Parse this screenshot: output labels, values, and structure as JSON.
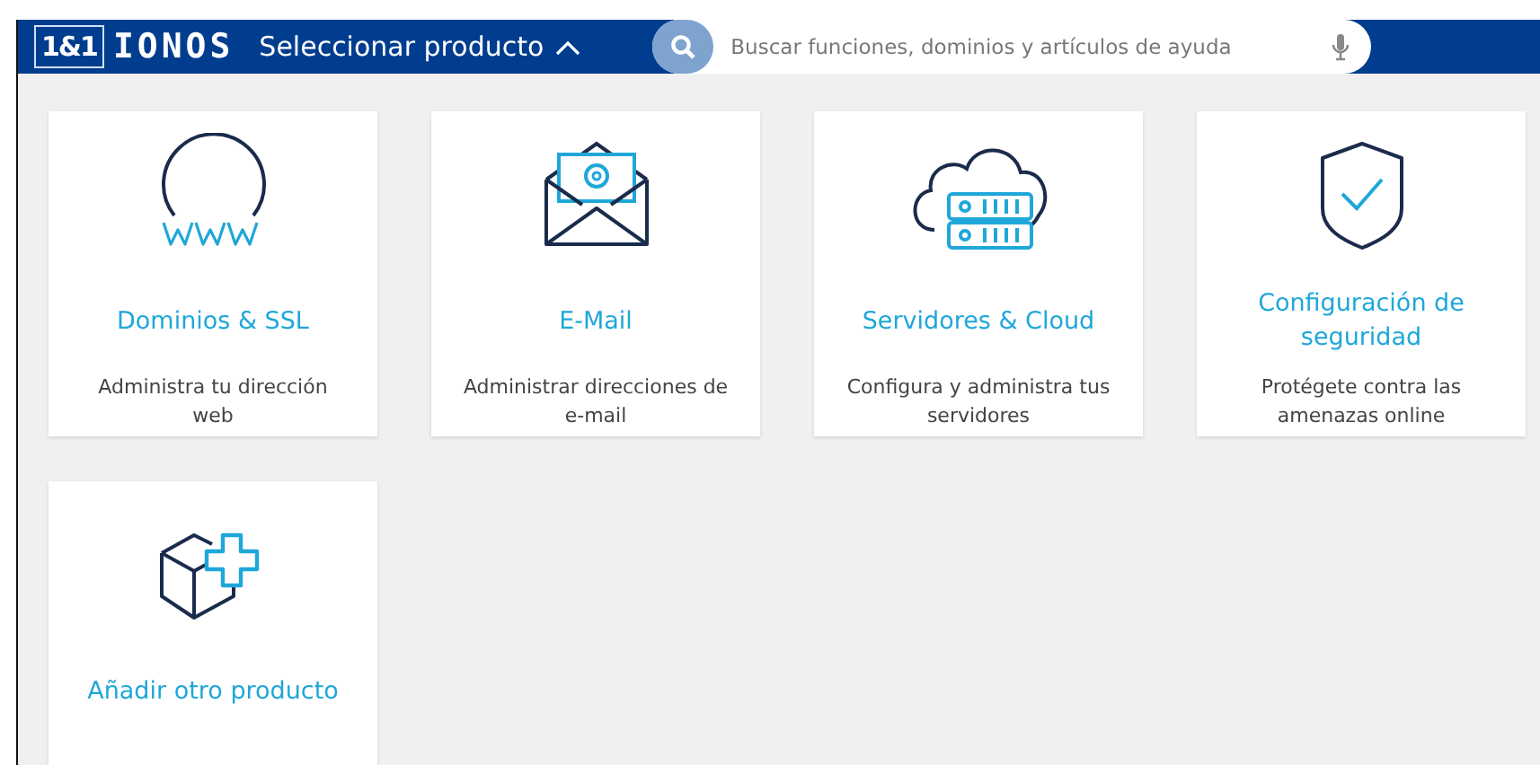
{
  "header": {
    "logo_mark": "1&1",
    "logo_text": "IONOS",
    "product_menu": {
      "label": "Seleccionar producto",
      "expanded": true
    },
    "search": {
      "placeholder": "Buscar funciones, dominios y artículos de ayuda"
    }
  },
  "products": [
    {
      "kind": "domains",
      "title": "Dominios & SSL",
      "description": "Administra tu dirección web"
    },
    {
      "kind": "email",
      "title": "E-Mail",
      "description": "Administrar direcciones de e-mail"
    },
    {
      "kind": "servers",
      "title": "Servidores & Cloud",
      "description": "Configura y administra tus servidores"
    },
    {
      "kind": "security",
      "title": "Configuración de seguridad",
      "description": "Protégete contra las amenazas online"
    },
    {
      "kind": "add",
      "title": "Añadir otro producto"
    }
  ]
}
